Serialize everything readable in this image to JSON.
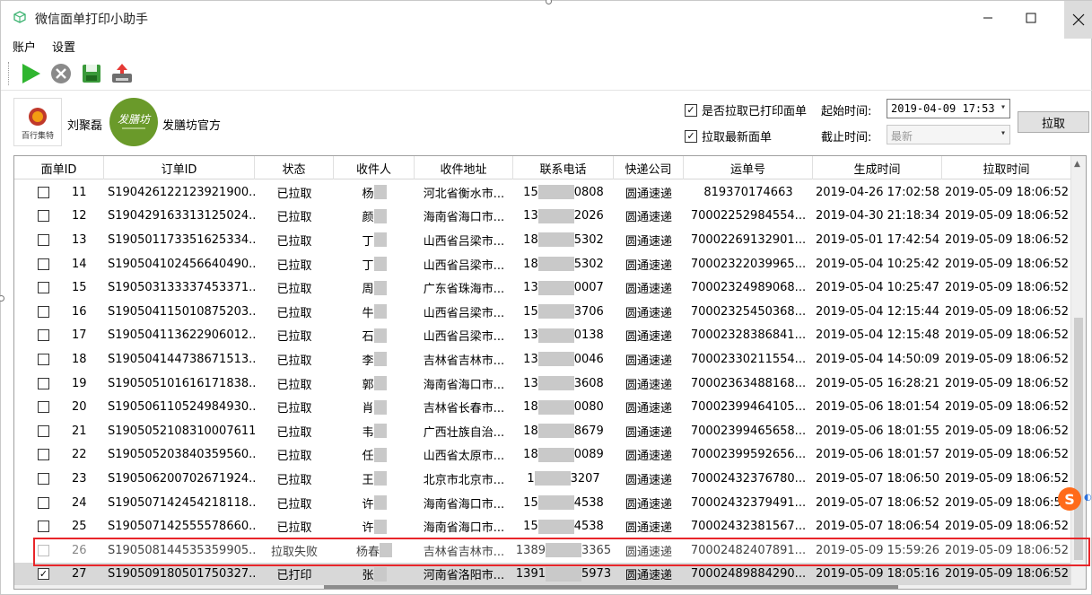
{
  "window": {
    "title": "微信面单打印小助手"
  },
  "menu": {
    "account": "账户",
    "settings": "设置"
  },
  "shops": [
    {
      "logo_text": "百行集特",
      "name": "刘聚磊"
    },
    {
      "logo_text": "发膳坊",
      "name": "发膳坊官方"
    }
  ],
  "options": {
    "pull_printed_label": "是否拉取已打印面单",
    "pull_printed_checked": true,
    "pull_latest_label": "拉取最新面单",
    "pull_latest_checked": true,
    "start_time_label": "起始时间:",
    "start_time_value": "2019-04-09 17:53",
    "end_time_label": "截止时间:",
    "end_time_value": "最新",
    "pull_button": "拉取"
  },
  "columns": [
    "面单ID",
    "订单ID",
    "状态",
    "收件人",
    "收件地址",
    "联系电话",
    "快递公司",
    "运单号",
    "生成时间",
    "拉取时间"
  ],
  "rows": [
    {
      "checked": false,
      "id": "11",
      "order": "S190426122123921900...",
      "status": "已拉取",
      "recipient": "杨",
      "address": "河北省衡水市...",
      "phone_head": "15",
      "phone_tail": "0808",
      "courier": "圆通速递",
      "waybill": "819370174663",
      "created": "2019-04-26 17:02:58",
      "pulled": "2019-05-09 18:06:52"
    },
    {
      "checked": false,
      "id": "12",
      "order": "S190429163313125024...",
      "status": "已拉取",
      "recipient": "颜",
      "address": "海南省海口市...",
      "phone_head": "13",
      "phone_tail": "2026",
      "courier": "圆通速递",
      "waybill": "70002252984554...",
      "created": "2019-04-30 21:18:34",
      "pulled": "2019-05-09 18:06:52"
    },
    {
      "checked": false,
      "id": "13",
      "order": "S190501173351625334...",
      "status": "已拉取",
      "recipient": "丁",
      "address": "山西省吕梁市...",
      "phone_head": "18",
      "phone_tail": "5302",
      "courier": "圆通速递",
      "waybill": "70002269132901...",
      "created": "2019-05-01 17:42:54",
      "pulled": "2019-05-09 18:06:52"
    },
    {
      "checked": false,
      "id": "14",
      "order": "S190504102456640490...",
      "status": "已拉取",
      "recipient": "丁",
      "address": "山西省吕梁市...",
      "phone_head": "18",
      "phone_tail": "5302",
      "courier": "圆通速递",
      "waybill": "70002322039965...",
      "created": "2019-05-04 10:25:42",
      "pulled": "2019-05-09 18:06:52"
    },
    {
      "checked": false,
      "id": "15",
      "order": "S190503133337453371...",
      "status": "已拉取",
      "recipient": "周",
      "address": "广东省珠海市...",
      "phone_head": "13",
      "phone_tail": "0007",
      "courier": "圆通速递",
      "waybill": "70002324989068...",
      "created": "2019-05-04 10:25:47",
      "pulled": "2019-05-09 18:06:52"
    },
    {
      "checked": false,
      "id": "16",
      "order": "S190504115010875203...",
      "status": "已拉取",
      "recipient": "牛",
      "address": "山西省吕梁市...",
      "phone_head": "15",
      "phone_tail": "3706",
      "courier": "圆通速递",
      "waybill": "70002325450368...",
      "created": "2019-05-04 12:15:44",
      "pulled": "2019-05-09 18:06:52"
    },
    {
      "checked": false,
      "id": "17",
      "order": "S190504113622906012...",
      "status": "已拉取",
      "recipient": "石",
      "address": "山西省吕梁市...",
      "phone_head": "13",
      "phone_tail": "0138",
      "courier": "圆通速递",
      "waybill": "70002328386841...",
      "created": "2019-05-04 12:15:48",
      "pulled": "2019-05-09 18:06:52"
    },
    {
      "checked": false,
      "id": "18",
      "order": "S190504144738671513...",
      "status": "已拉取",
      "recipient": "李",
      "address": "吉林省吉林市...",
      "phone_head": "13",
      "phone_tail": "0046",
      "courier": "圆通速递",
      "waybill": "70002330211554...",
      "created": "2019-05-04 14:50:09",
      "pulled": "2019-05-09 18:06:52"
    },
    {
      "checked": false,
      "id": "19",
      "order": "S190505101616171838...",
      "status": "已拉取",
      "recipient": "郭",
      "address": "海南省海口市...",
      "phone_head": "13",
      "phone_tail": "3608",
      "courier": "圆通速递",
      "waybill": "70002363488168...",
      "created": "2019-05-05 16:28:21",
      "pulled": "2019-05-09 18:06:52"
    },
    {
      "checked": false,
      "id": "20",
      "order": "S190506110524984930...",
      "status": "已拉取",
      "recipient": "肖",
      "address": "吉林省长春市...",
      "phone_head": "18",
      "phone_tail": "0080",
      "courier": "圆通速递",
      "waybill": "70002399464105...",
      "created": "2019-05-06 18:01:54",
      "pulled": "2019-05-09 18:06:52"
    },
    {
      "checked": false,
      "id": "21",
      "order": "S1905052108310007611",
      "status": "已拉取",
      "recipient": "韦",
      "address": "广西壮族自治...",
      "phone_head": "18",
      "phone_tail": "8679",
      "courier": "圆通速递",
      "waybill": "70002399465658...",
      "created": "2019-05-06 18:01:55",
      "pulled": "2019-05-09 18:06:52"
    },
    {
      "checked": false,
      "id": "22",
      "order": "S190505203840359560...",
      "status": "已拉取",
      "recipient": "任",
      "address": "山西省太原市...",
      "phone_head": "18",
      "phone_tail": "0089",
      "courier": "圆通速递",
      "waybill": "70002399592656...",
      "created": "2019-05-06 18:01:57",
      "pulled": "2019-05-09 18:06:52"
    },
    {
      "checked": false,
      "id": "23",
      "order": "S190506200702671924...",
      "status": "已拉取",
      "recipient": "王",
      "address": "北京市北京市...",
      "phone_head": "1",
      "phone_tail": "3207",
      "courier": "圆通速递",
      "waybill": "70002432376780...",
      "created": "2019-05-07 18:06:50",
      "pulled": "2019-05-09 18:06:52"
    },
    {
      "checked": false,
      "id": "24",
      "order": "S190507142454218118...",
      "status": "已拉取",
      "recipient": "许",
      "address": "海南省海口市...",
      "phone_head": "15",
      "phone_tail": "4538",
      "courier": "圆通速递",
      "waybill": "70002432379491...",
      "created": "2019-05-07 18:06:52",
      "pulled": "2019-05-09 18:06:52"
    },
    {
      "checked": false,
      "id": "25",
      "order": "S190507142555578660...",
      "status": "已拉取",
      "recipient": "许",
      "address": "海南省海口市...",
      "phone_head": "15",
      "phone_tail": "4538",
      "courier": "圆通速递",
      "waybill": "70002432381567...",
      "created": "2019-05-07 18:06:54",
      "pulled": "2019-05-09 18:06:52"
    },
    {
      "checked": false,
      "id": "26",
      "order": "S190508144535359905...",
      "status": "拉取失败",
      "recipient": "杨春",
      "address": "吉林省吉林市...",
      "phone_head": "1389",
      "phone_tail": "3365",
      "courier": "圆通速递",
      "waybill": "70002482407891...",
      "created": "2019-05-09 15:59:26",
      "pulled": "2019-05-09 18:06:52",
      "failed": true
    },
    {
      "checked": true,
      "id": "27",
      "order": "S190509180501750327...",
      "status": "已打印",
      "recipient": "张",
      "address": "河南省洛阳市...",
      "phone_head": "1391",
      "phone_tail": "5973",
      "courier": "圆通速递",
      "waybill": "70002489884290...",
      "created": "2019-05-09 18:05:16",
      "pulled": "2019-05-09 18:06:52",
      "selected": true
    }
  ],
  "colors": {
    "highlight": "#e8262a",
    "play_green": "#2fb52f",
    "selected_row": "#d8d8d8"
  }
}
